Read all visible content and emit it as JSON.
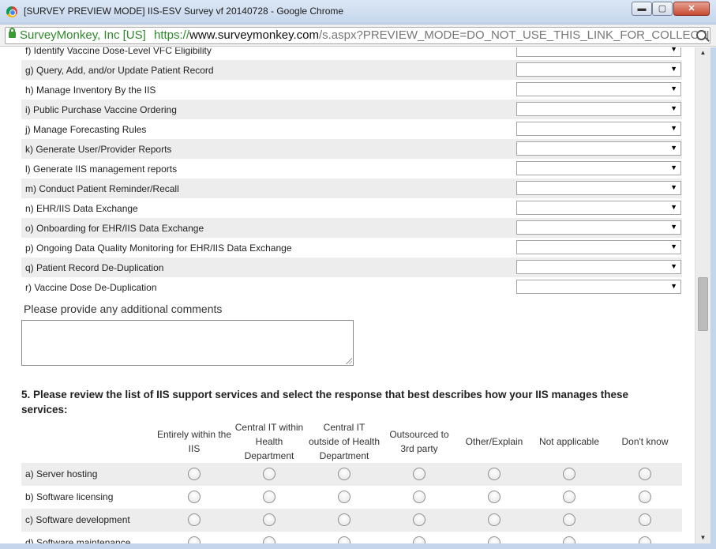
{
  "window": {
    "title": "[SURVEY PREVIEW MODE] IIS-ESV Survey vf 20140728 - Google Chrome",
    "min_label": "▬",
    "max_label": "▢",
    "close_label": "✕"
  },
  "address": {
    "ev_name": "SurveyMonkey, Inc [US]",
    "scheme": "https://",
    "host": "www.surveymonkey.com",
    "path": "/s.aspx?PREVIEW_MODE=DO_NOT_USE_THIS_LINK_FOR_COLLECTION"
  },
  "matrix4": {
    "rows": [
      {
        "label": "f) Identify Vaccine Dose-Level VFC Eligibility"
      },
      {
        "label": "g) Query, Add, and/or Update Patient Record"
      },
      {
        "label": "h) Manage Inventory By the IIS"
      },
      {
        "label": "i) Public Purchase Vaccine Ordering"
      },
      {
        "label": "j) Manage Forecasting Rules"
      },
      {
        "label": "k) Generate User/Provider Reports"
      },
      {
        "label": "l) Generate IIS management reports"
      },
      {
        "label": "m) Conduct Patient Reminder/Recall"
      },
      {
        "label": "n) EHR/IIS Data Exchange"
      },
      {
        "label": "o) Onboarding for EHR/IIS Data Exchange"
      },
      {
        "label": "p) Ongoing Data Quality Monitoring for EHR/IIS Data Exchange"
      },
      {
        "label": "q) Patient Record De-Duplication"
      },
      {
        "label": "r) Vaccine Dose De-Duplication"
      }
    ],
    "select_value": "",
    "arrow": "▼"
  },
  "comments": {
    "label": "Please provide any additional comments",
    "value": ""
  },
  "q5": {
    "text": "5. Please review the list of IIS support services and select the response that best describes how your IIS manages these services:",
    "columns": [
      [
        "Entirely within the",
        "IIS"
      ],
      [
        "Central IT within",
        "Health",
        "Department"
      ],
      [
        "Central IT",
        "outside of Health",
        "Department"
      ],
      [
        "Outsourced to",
        "3rd party"
      ],
      [
        "Other/Explain"
      ],
      [
        "Not applicable"
      ],
      [
        "Don't know"
      ]
    ],
    "rows": [
      {
        "label": "a) Server hosting"
      },
      {
        "label": "b) Software licensing"
      },
      {
        "label": "c) Software development"
      },
      {
        "label": "d) Software maintenance"
      }
    ]
  },
  "scrollbar": {
    "up": "▲",
    "down": "▼"
  }
}
